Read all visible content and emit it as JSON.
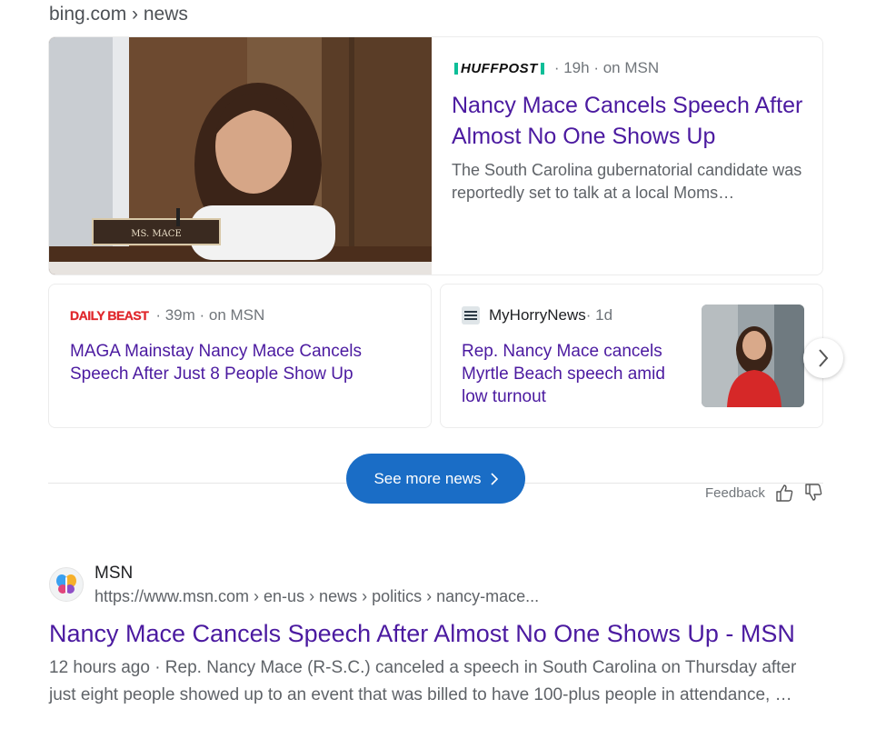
{
  "header": {
    "breadcrumb": "bing.com › news"
  },
  "main_card": {
    "source": "HUFFPOST",
    "meta": "· 19h · on MSN",
    "headline": "Nancy Mace Cancels Speech After Almost No One Shows Up",
    "snippet": "The South Carolina gubernatorial candidate was reportedly set to talk at a local Moms…",
    "nameplate": "MS. MACE"
  },
  "card_a": {
    "source": "DAILY BEAST",
    "meta": "· 39m · on MSN",
    "headline": "MAGA Mainstay Nancy Mace Cancels Speech After Just 8 People Show Up"
  },
  "card_b": {
    "source": "MyHorryNews",
    "meta": " · 1d",
    "headline": "Rep. Nancy Mace cancels Myrtle Beach speech amid low turnout"
  },
  "see_more": {
    "label": "See more news"
  },
  "feedback": {
    "label": "Feedback"
  },
  "result": {
    "site_name": "MSN",
    "url": "https://www.msn.com › en-us › news › politics › nancy-mace...",
    "title": "Nancy Mace Cancels Speech After Almost No One Shows Up - MSN",
    "snippet": "12 hours ago · Rep. Nancy Mace (R-S.C.) canceled a speech in South Carolina on Thursday after just eight people showed up to an event that was billed to have 100-plus people in attendance, …"
  },
  "colors": {
    "link": "#4b1aa0",
    "button": "#1a6dc6",
    "huffpost_green": "#0dbe98",
    "dailybeast_red": "#e0282d"
  }
}
